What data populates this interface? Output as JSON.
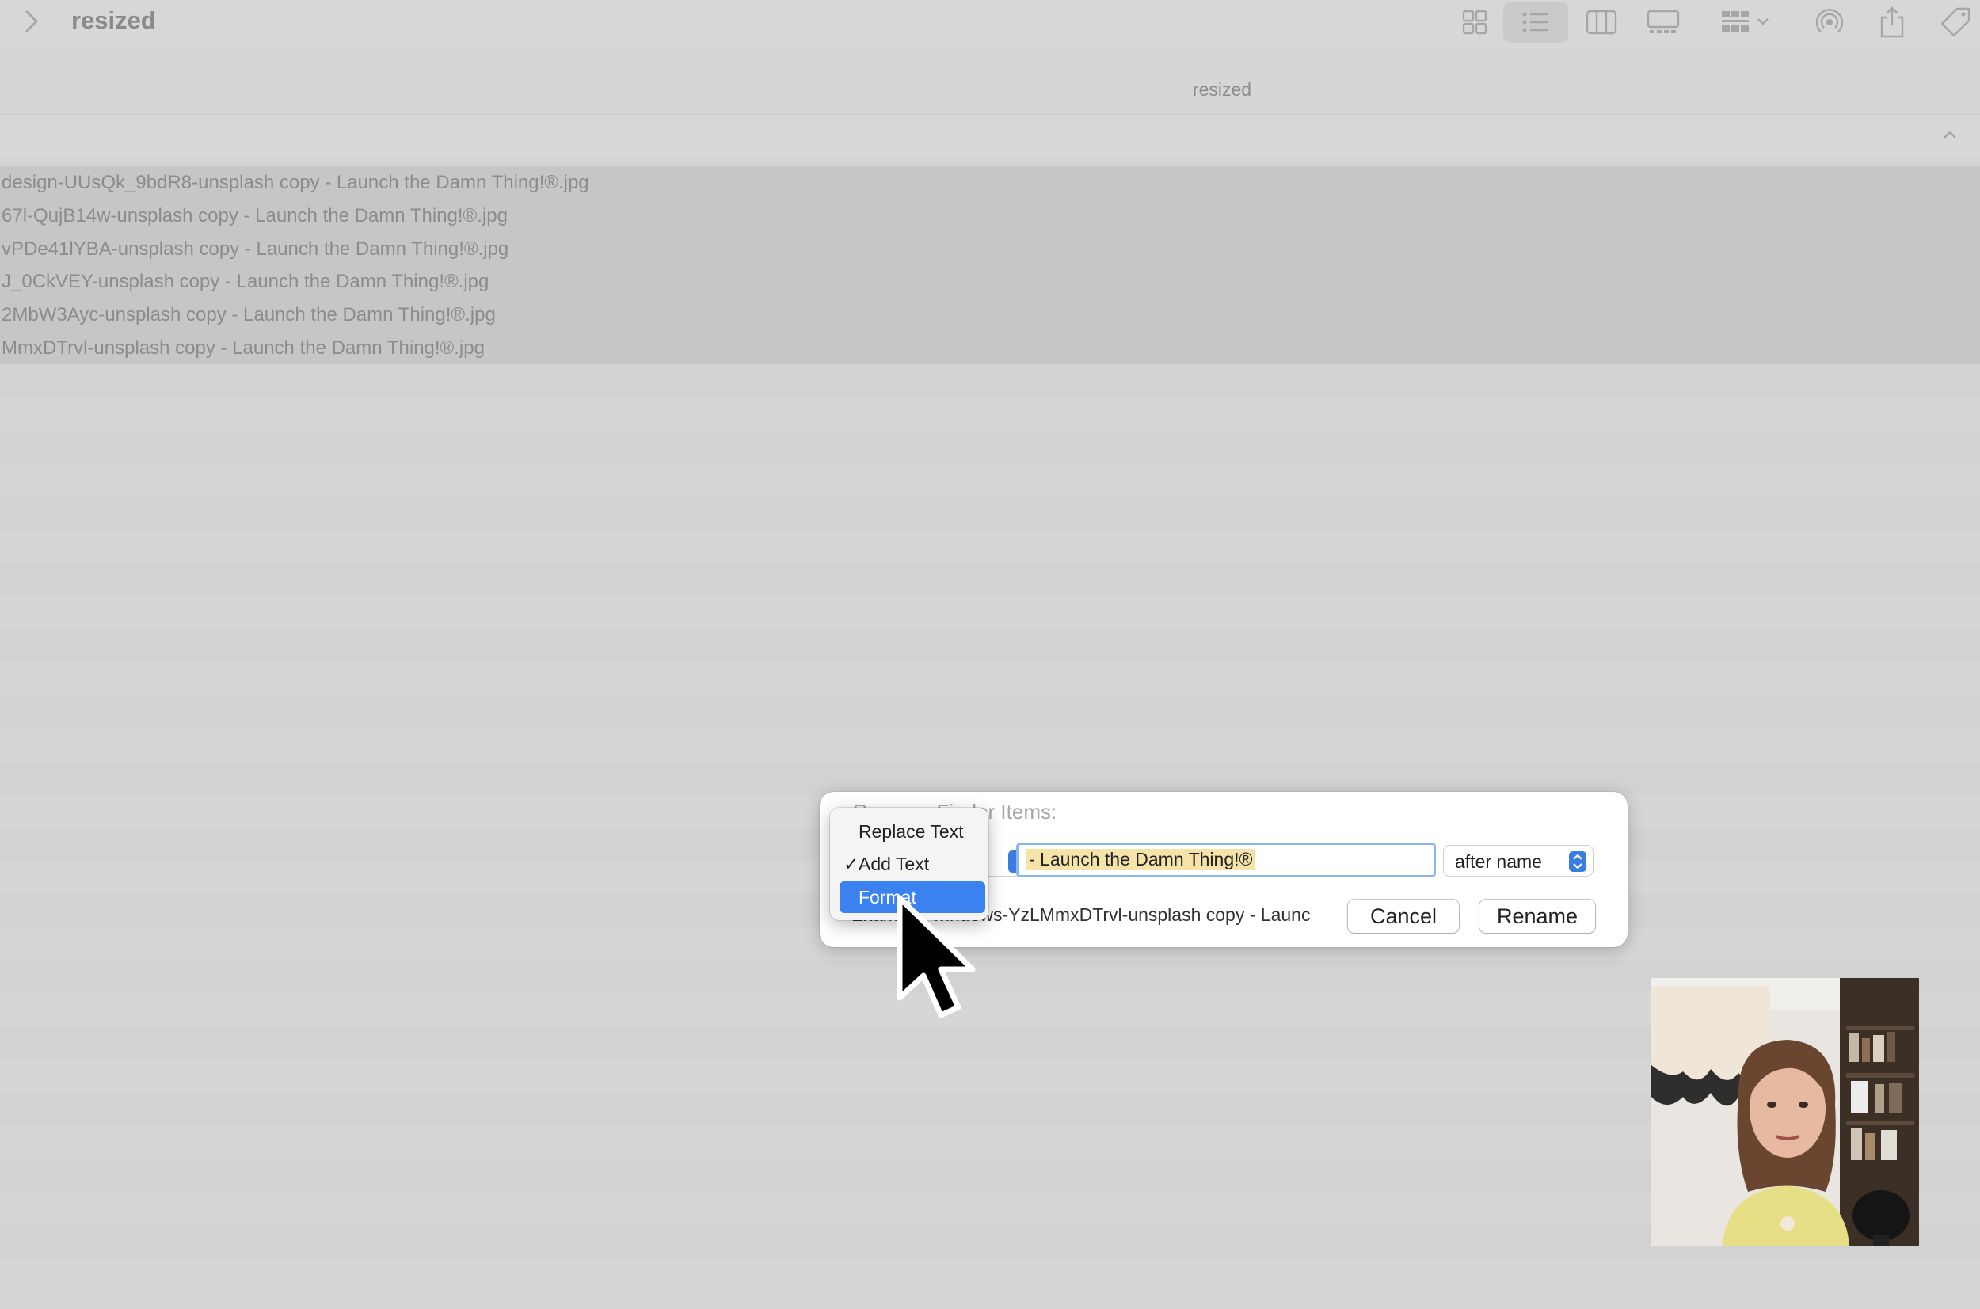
{
  "window": {
    "title": "resized",
    "path_title": "resized"
  },
  "toolbar": {
    "icons": [
      "icon-view-icon",
      "list-view-icon",
      "column-view-icon",
      "gallery-view-icon",
      "group-icon",
      "airdrop-icon",
      "share-icon",
      "tag-icon"
    ],
    "active_view": "list"
  },
  "files": [
    "design-UUsQk_9bdR8-unsplash copy - Launch the Damn Thing!®.jpg",
    "67l-QujB14w-unsplash copy - Launch the Damn Thing!®.jpg",
    "vPDe41lYBA-unsplash copy - Launch the Damn Thing!®.jpg",
    "J_0CkVEY-unsplash copy - Launch the Damn Thing!®.jpg",
    "2MbW3Ayc-unsplash copy - Launch the Damn Thing!®.jpg",
    "MmxDTrvl-unsplash copy - Launch the Damn Thing!®.jpg"
  ],
  "dialog": {
    "title": "Rename Finder Items:",
    "text_value": "- Launch the Damn Thing!®",
    "position_select": "after name",
    "example": "Example: windows-YzLMmxDTrvl-unsplash copy - Launc",
    "cancel_label": "Cancel",
    "rename_label": "Rename"
  },
  "menu": {
    "items": [
      {
        "label": "Replace Text",
        "checked": false,
        "highlighted": false
      },
      {
        "label": "Add Text",
        "checked": true,
        "highlighted": false
      },
      {
        "label": "Format",
        "checked": false,
        "highlighted": true
      }
    ],
    "check_mark": "✓"
  },
  "colors": {
    "accent": "#3b82f0",
    "highlight_text_bg": "#f6e3a8",
    "dimmed_background": "#d4d4d4"
  }
}
